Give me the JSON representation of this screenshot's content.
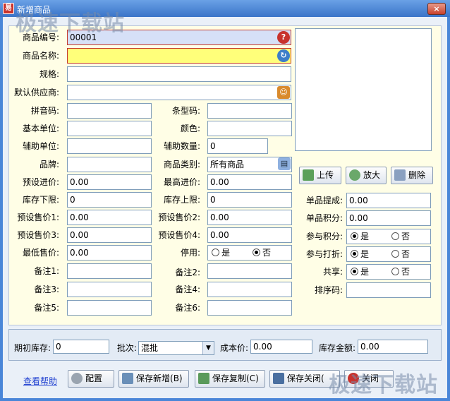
{
  "window": {
    "title": "新增商品",
    "icon_text": "易",
    "close_label": "×"
  },
  "watermark": "极速下载站",
  "fields": {
    "code": {
      "label": "商品编号:",
      "value": "00001"
    },
    "name": {
      "label": "商品名称:",
      "value": ""
    },
    "spec": {
      "label": "规格:",
      "value": ""
    },
    "supplier": {
      "label": "默认供应商:",
      "value": ""
    },
    "pinyin": {
      "label": "拼音码:",
      "value": ""
    },
    "barcode": {
      "label": "条型码:",
      "value": ""
    },
    "base_unit": {
      "label": "基本单位:",
      "value": ""
    },
    "color": {
      "label": "颜色:",
      "value": ""
    },
    "aux_unit": {
      "label": "辅助单位:",
      "value": ""
    },
    "aux_qty": {
      "label": "辅助数量:",
      "value": "0"
    },
    "brand": {
      "label": "品牌:",
      "value": ""
    },
    "category": {
      "label": "商品类别:",
      "value": "所有商品"
    },
    "preset_cost": {
      "label": "预设进价:",
      "value": "0.00"
    },
    "max_cost": {
      "label": "最高进价:",
      "value": "0.00"
    },
    "stock_min": {
      "label": "库存下限:",
      "value": "0"
    },
    "stock_max": {
      "label": "库存上限:",
      "value": "0"
    },
    "price1": {
      "label": "预设售价1:",
      "value": "0.00"
    },
    "price2": {
      "label": "预设售价2:",
      "value": "0.00"
    },
    "price3": {
      "label": "预设售价3:",
      "value": "0.00"
    },
    "price4": {
      "label": "预设售价4:",
      "value": "0.00"
    },
    "min_price": {
      "label": "最低售价:",
      "value": "0.00"
    },
    "disabled": {
      "label": "停用:",
      "yes": "是",
      "no": "否"
    },
    "note1": {
      "label": "备注1:",
      "value": ""
    },
    "note2": {
      "label": "备注2:",
      "value": ""
    },
    "note3": {
      "label": "备注3:",
      "value": ""
    },
    "note4": {
      "label": "备注4:",
      "value": ""
    },
    "note5": {
      "label": "备注5:",
      "value": ""
    },
    "note6": {
      "label": "备注6:",
      "value": ""
    },
    "commission": {
      "label": "单品提成:",
      "value": "0.00"
    },
    "points": {
      "label": "单品积分:",
      "value": "0.00"
    },
    "join_points": {
      "label": "参与积分:",
      "yes": "是",
      "no": "否"
    },
    "join_discount": {
      "label": "参与打折:",
      "yes": "是",
      "no": "否"
    },
    "share": {
      "label": "共享:",
      "yes": "是",
      "no": "否"
    },
    "sort_code": {
      "label": "排序码:",
      "value": ""
    }
  },
  "image_buttons": {
    "upload": "上传",
    "zoom": "放大",
    "delete": "删除"
  },
  "bottom": {
    "init_stock": {
      "label": "期初库存:",
      "value": "0"
    },
    "batch": {
      "label": "批次:",
      "value": "混批"
    },
    "cost": {
      "label": "成本价:",
      "value": "0.00"
    },
    "amount": {
      "label": "库存金额:",
      "value": "0.00"
    }
  },
  "footer": {
    "help": "查看帮助",
    "config": "配置",
    "save_new": "保存新增",
    "save_new_key": "(B)",
    "save_copy": "保存复制",
    "save_copy_key": "(C)",
    "save_close": "保存关闭",
    "save_close_key": "(",
    "close": "关闭"
  }
}
